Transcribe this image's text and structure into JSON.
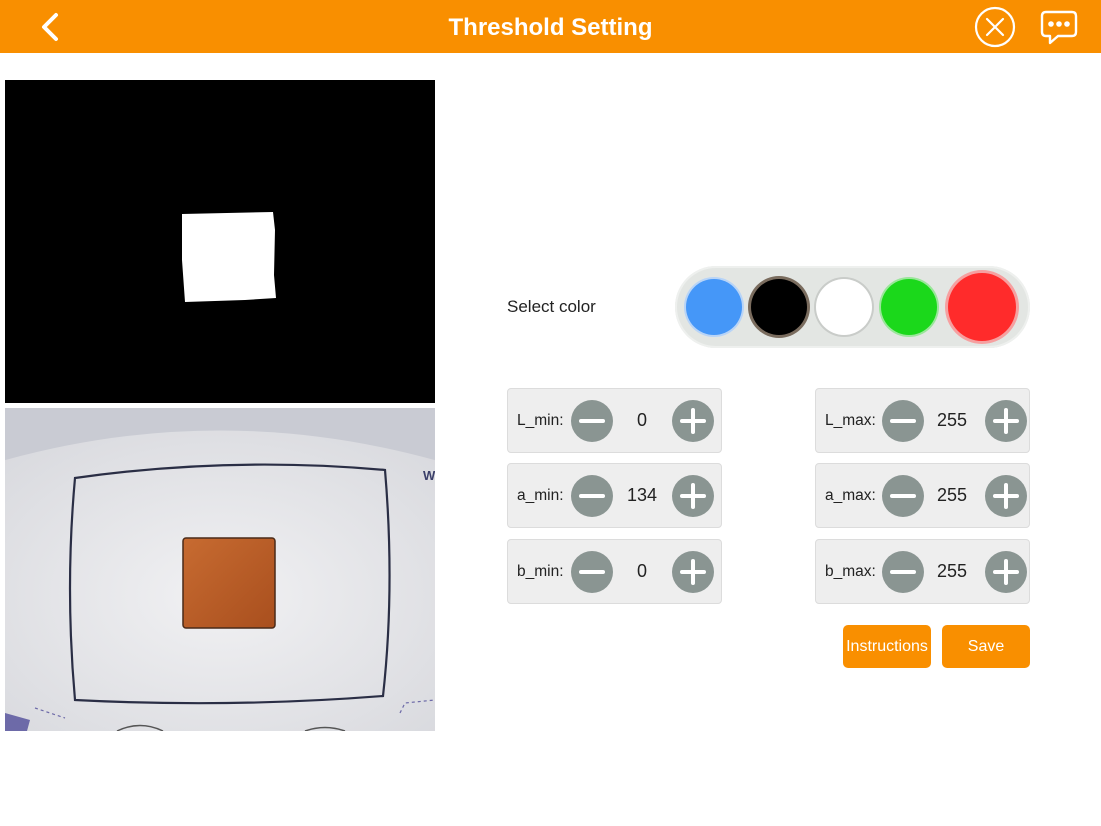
{
  "header": {
    "title": "Threshold Setting"
  },
  "select_color": {
    "label": "Select color",
    "swatches": [
      {
        "name": "blue",
        "color": "#4597f8"
      },
      {
        "name": "black",
        "color": "#000000"
      },
      {
        "name": "white",
        "color": "#ffffff"
      },
      {
        "name": "green",
        "color": "#1bd81b"
      },
      {
        "name": "red",
        "color": "#ff2b2b"
      }
    ],
    "selected": "red"
  },
  "thresholds": {
    "l_min": {
      "label": "L_min:",
      "value": "0"
    },
    "a_min": {
      "label": "a_min:",
      "value": "134"
    },
    "b_min": {
      "label": "b_min:",
      "value": "0"
    },
    "l_max": {
      "label": "L_max:",
      "value": "255"
    },
    "a_max": {
      "label": "a_max:",
      "value": "255"
    },
    "b_max": {
      "label": "b_max:",
      "value": "255"
    }
  },
  "buttons": {
    "instructions": "Instructions",
    "save": "Save"
  },
  "colors": {
    "accent": "#f98f00",
    "stepper_button": "#8a9592"
  },
  "icons": {
    "back": "chevron-left-icon",
    "close": "close-circle-icon",
    "chat": "chat-bubble-icon",
    "minus": "minus-circle-icon",
    "plus": "plus-circle-icon"
  }
}
